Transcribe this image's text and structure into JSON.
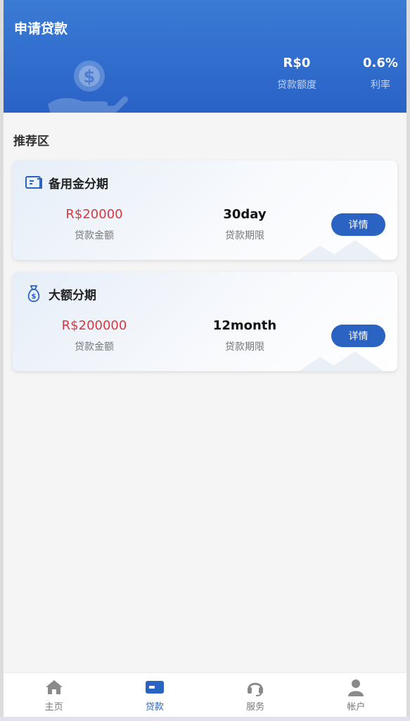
{
  "header": {
    "title": "申请贷款",
    "stats": [
      {
        "value": "R$0",
        "label": "贷款额度"
      },
      {
        "value": "0.6%",
        "label": "利率"
      }
    ]
  },
  "section": {
    "title": "推荐区"
  },
  "products": [
    {
      "icon": "wallet-card-icon",
      "name": "备用金分期",
      "amount": "R$20000",
      "amount_label": "贷款金额",
      "term": "30day",
      "term_label": "贷款期限",
      "button": "详情"
    },
    {
      "icon": "money-bag-icon",
      "name": "大额分期",
      "amount": "R$200000",
      "amount_label": "贷款金额",
      "term": "12month",
      "term_label": "贷款期限",
      "button": "详情"
    }
  ],
  "tabbar": {
    "active": "贷款",
    "items": [
      {
        "label": "主页",
        "icon": "home-icon"
      },
      {
        "label": "贷款",
        "icon": "loan-card-icon"
      },
      {
        "label": "服务",
        "icon": "headset-icon"
      },
      {
        "label": "帐户",
        "icon": "user-icon"
      }
    ]
  },
  "colors": {
    "primary": "#2b63c3",
    "header_top": "#3a7bd5",
    "amount_red": "#d9383f",
    "background": "#f5f5f5"
  }
}
